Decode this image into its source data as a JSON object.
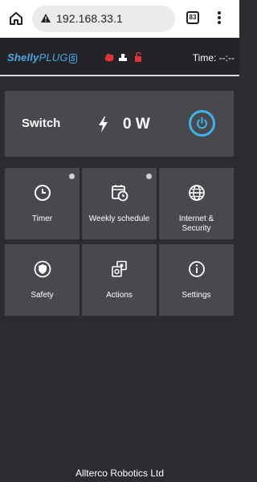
{
  "browser": {
    "url": "192.168.33.1",
    "tab_count": "83"
  },
  "header": {
    "logo_brand": "Shelly",
    "logo_product": "PLUG",
    "logo_variant": "S",
    "time_label": "Time: --:--"
  },
  "switch_card": {
    "label": "Switch",
    "power_value": "0 W"
  },
  "tiles": [
    {
      "label": "Timer",
      "icon": "clock-icon",
      "has_dot": true
    },
    {
      "label": "Weekly schedule",
      "icon": "calendar-clock-icon",
      "has_dot": true
    },
    {
      "label": "Internet & Security",
      "icon": "globe-icon",
      "has_dot": false
    },
    {
      "label": "Safety",
      "icon": "shield-icon",
      "has_dot": false
    },
    {
      "label": "Actions",
      "icon": "actions-icon",
      "has_dot": false
    },
    {
      "label": "Settings",
      "icon": "info-icon",
      "has_dot": false
    }
  ],
  "footer": {
    "text": "Allterco Robotics Ltd"
  },
  "colors": {
    "accent": "#3fb1ee",
    "background": "#2b2c30",
    "card": "#48494d",
    "status_red": "#e2323a"
  }
}
